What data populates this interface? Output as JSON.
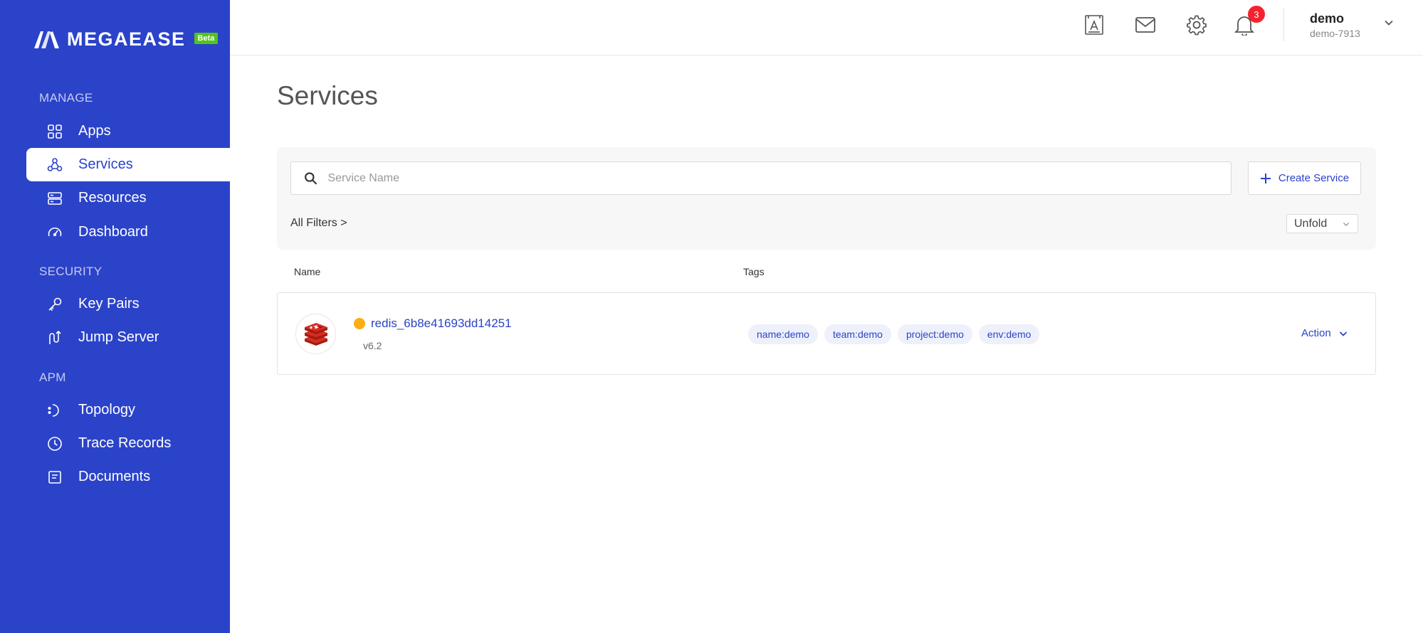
{
  "brand": {
    "name": "MEGAEASE",
    "badge": "Beta"
  },
  "sidebar": {
    "sections": [
      {
        "title": "MANAGE",
        "items": [
          {
            "label": "Apps",
            "icon": "apps-grid-icon"
          },
          {
            "label": "Services",
            "icon": "services-icon",
            "active": true
          },
          {
            "label": "Resources",
            "icon": "resources-icon"
          },
          {
            "label": "Dashboard",
            "icon": "dashboard-gauge-icon"
          }
        ]
      },
      {
        "title": "SECURITY",
        "items": [
          {
            "label": "Key Pairs",
            "icon": "key-icon"
          },
          {
            "label": "Jump Server",
            "icon": "jump-server-icon"
          }
        ]
      },
      {
        "title": "APM",
        "items": [
          {
            "label": "Topology",
            "icon": "topology-icon"
          },
          {
            "label": "Trace Records",
            "icon": "clock-icon"
          },
          {
            "label": "Documents",
            "icon": "document-icon"
          }
        ]
      }
    ]
  },
  "header": {
    "notifications_count": "3",
    "user": {
      "name": "demo",
      "id": "demo-7913"
    }
  },
  "main": {
    "title": "Services",
    "search": {
      "placeholder": "Service Name",
      "value": ""
    },
    "create_button": "Create Service",
    "all_filters": "All Filters >",
    "unfold_select": "Unfold",
    "columns": {
      "name": "Name",
      "tags": "Tags"
    },
    "services": [
      {
        "name": "redis_6b8e41693dd14251",
        "version": "v6.2",
        "status_color": "#faad14",
        "tags": [
          "name:demo",
          "team:demo",
          "project:demo",
          "env:demo"
        ],
        "action": "Action"
      }
    ]
  },
  "colors": {
    "brand": "#2b43c9",
    "status_pending": "#faad14",
    "badge_green": "#52c41a",
    "notification": "#f5222d"
  }
}
